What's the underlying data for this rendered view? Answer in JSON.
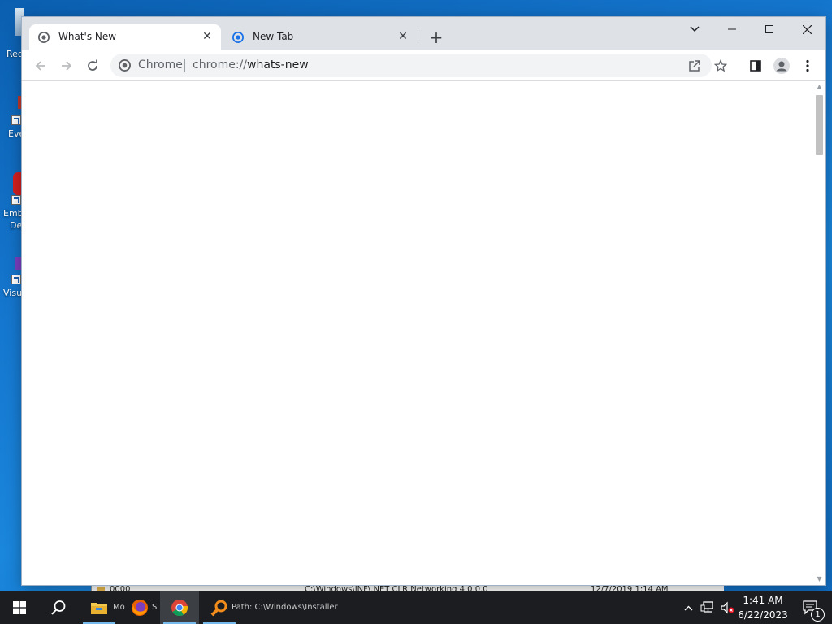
{
  "desktop": {
    "icons": [
      {
        "label": "Rec"
      },
      {
        "label": "Eve"
      },
      {
        "label": "Emb"
      },
      {
        "label": "De"
      },
      {
        "label": "Visu"
      }
    ],
    "background_window": {
      "name_text": "0000",
      "path_text": "C:\\Windows\\INF\\.NET CLR Networking 4.0.0.0",
      "date_text": "12/7/2019 1:14 AM"
    }
  },
  "browser": {
    "tabs": [
      {
        "title": "What's New",
        "active": true
      },
      {
        "title": "New Tab",
        "active": false
      }
    ],
    "omnibox": {
      "scheme_label": "Chrome",
      "url_prefix": "chrome://",
      "url_host": "whats-new"
    },
    "colors": {
      "titlebar": "#dee1e6",
      "omnibox_bg": "#f1f3f4",
      "accent_blue": "#1a73e8"
    }
  },
  "taskbar": {
    "clock_time": "1:41 AM",
    "clock_date": "6/22/2023",
    "notification_count": "1",
    "ghost_text_firefox": "Mo",
    "ghost_text_chrome": "S",
    "ghost_text_path": "Path: C:\\Windows\\Installer"
  }
}
